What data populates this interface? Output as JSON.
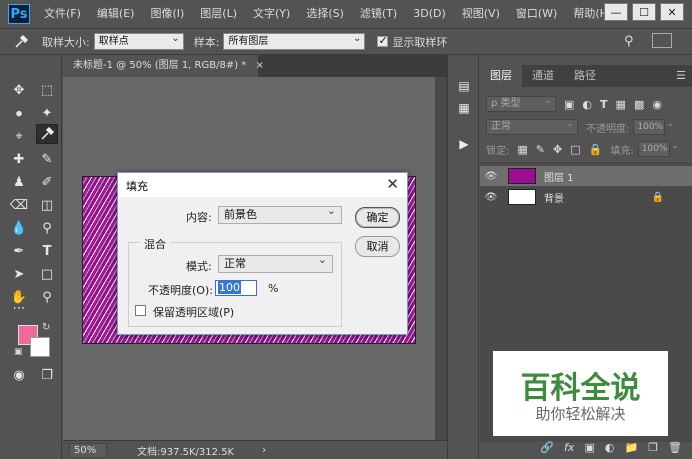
{
  "app": {
    "logo": "Ps",
    "menu": [
      "文件(F)",
      "编辑(E)",
      "图像(I)",
      "图层(L)",
      "文字(Y)",
      "选择(S)",
      "滤镜(T)",
      "3D(D)",
      "视图(V)",
      "窗口(W)",
      "帮助(H)"
    ],
    "window_controls": [
      "—",
      "☐",
      "✕"
    ]
  },
  "options_bar": {
    "sample_size_label": "取样大小:",
    "sample_size_value": "取样点",
    "sample_label": "样本:",
    "sample_value": "所有图层",
    "show_ring_label": "显示取样环",
    "show_ring_checked": true
  },
  "document": {
    "tab_title": "未标题-1 @ 50% (图层 1, RGB/8#) *",
    "tab_close": "×",
    "zoom": "50%",
    "doc_size": "文档:937.5K/312.5K",
    "status_arrow": "›"
  },
  "colors": {
    "foreground": "#ef6a9c",
    "background": "#ffffff",
    "layer1_thumb": "#9a0f8f"
  },
  "layers_panel": {
    "tabs": [
      "图层",
      "通道",
      "路径"
    ],
    "active_tab": 0,
    "filter_kind": "ρ 类型",
    "blend_mode": "正常",
    "opacity_label": "不透明度:",
    "opacity_value": "100%",
    "lock_label": "锁定:",
    "fill_label": "填充:",
    "fill_value": "100%",
    "layers": [
      {
        "name": "图层 1",
        "selected": true
      },
      {
        "name": "背景",
        "selected": false
      }
    ],
    "footer_icons": [
      "link-icon",
      "fx-icon",
      "mask-icon",
      "adjustment-icon",
      "group-icon",
      "new-layer-icon",
      "trash-icon"
    ]
  },
  "watermark": {
    "title": "百科全说",
    "subtitle": "助你轻松解决"
  },
  "fill_dialog": {
    "title": "填充",
    "close": "✕",
    "contents_label": "内容:",
    "contents_value": "前景色",
    "ok_label": "确定",
    "cancel_label": "取消",
    "blending_legend": "混合",
    "mode_label": "模式:",
    "mode_value": "正常",
    "opacity_label": "不透明度(O):",
    "opacity_value": "100",
    "opacity_unit": "%",
    "preserve_label": "保留透明区域(P)",
    "preserve_checked": false
  }
}
